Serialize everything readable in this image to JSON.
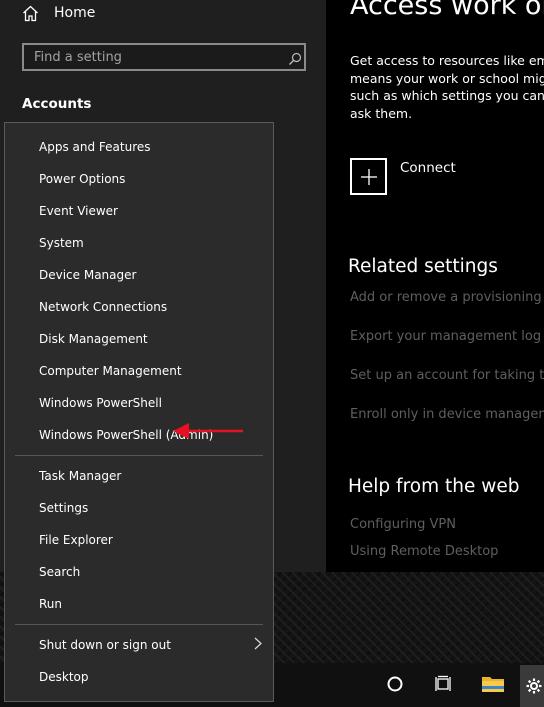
{
  "sidebar": {
    "home_label": "Home",
    "search_placeholder": "Find a setting",
    "section_label": "Accounts"
  },
  "main": {
    "title": "Access work or s",
    "description_lines": [
      "Get access to resources like ema",
      "means your work or school mig",
      "such as which settings you can c",
      "ask them."
    ],
    "connect_label": "Connect",
    "related_heading": "Related settings",
    "related_links": [
      "Add or remove a provisioning p",
      "Export your management log fi",
      "Set up an account for taking tes",
      "Enroll only in device manageme"
    ],
    "help_heading": "Help from the web",
    "help_links": [
      "Configuring VPN",
      "Using Remote Desktop"
    ]
  },
  "context_menu": {
    "items": [
      "Apps and Features",
      "Power Options",
      "Event Viewer",
      "System",
      "Device Manager",
      "Network Connections",
      "Disk Management",
      "Computer Management",
      "Windows PowerShell",
      "Windows PowerShell (Admin)",
      "Task Manager",
      "Settings",
      "File Explorer",
      "Search",
      "Run",
      "Shut down or sign out",
      "Desktop"
    ],
    "highlighted_item": "Network Connections",
    "arrow_color": "#e81123"
  },
  "taskbar": {
    "icons": [
      "cortana-icon",
      "task-view-icon",
      "file-explorer-icon",
      "settings-icon"
    ]
  }
}
